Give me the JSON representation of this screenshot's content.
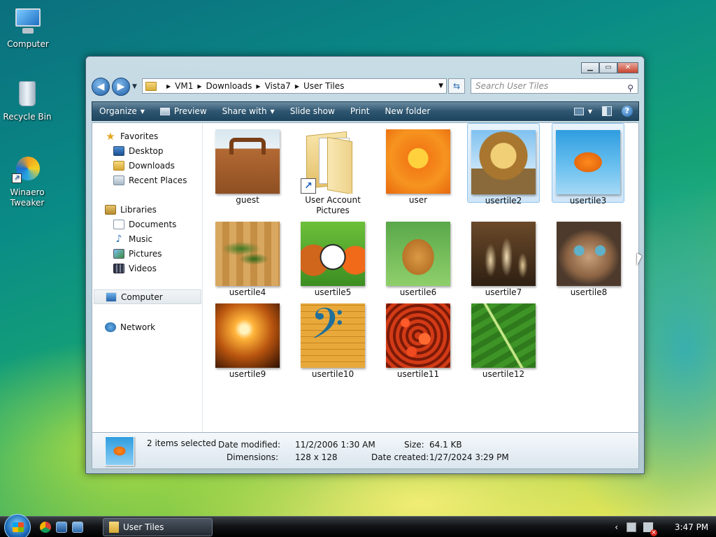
{
  "desktop": {
    "icons": [
      {
        "label": "Computer"
      },
      {
        "label": "Recycle Bin"
      },
      {
        "label": "Winaero Tweaker"
      }
    ]
  },
  "window": {
    "controls": {
      "minimize": "▁",
      "maximize": "▭",
      "close": "✕"
    },
    "nav": {
      "back": "◀",
      "forward": "▶"
    },
    "address": {
      "crumbs": [
        "VM1",
        "Downloads",
        "Vista7",
        "User Tiles"
      ],
      "separator": "▶"
    },
    "search": {
      "placeholder": "Search User Tiles"
    },
    "toolbar": {
      "organize": "Organize",
      "preview": "Preview",
      "share_with": "Share with",
      "slide_show": "Slide show",
      "print": "Print",
      "new_folder": "New folder",
      "help": "?"
    },
    "nav_pane": {
      "favorites": "Favorites",
      "desktop": "Desktop",
      "downloads": "Downloads",
      "recent_places": "Recent Places",
      "libraries": "Libraries",
      "documents": "Documents",
      "music": "Music",
      "pictures": "Pictures",
      "videos": "Videos",
      "computer": "Computer",
      "network": "Network"
    },
    "files": [
      {
        "name": "guest",
        "selected": false
      },
      {
        "name": "User Account Pictures",
        "selected": false
      },
      {
        "name": "user",
        "selected": false
      },
      {
        "name": "usertile2",
        "selected": true
      },
      {
        "name": "usertile3",
        "selected": true
      },
      {
        "name": "usertile4",
        "selected": false
      },
      {
        "name": "usertile5",
        "selected": false
      },
      {
        "name": "usertile6",
        "selected": false
      },
      {
        "name": "usertile7",
        "selected": false
      },
      {
        "name": "usertile8",
        "selected": false
      },
      {
        "name": "usertile9",
        "selected": false
      },
      {
        "name": "usertile10",
        "selected": false
      },
      {
        "name": "usertile11",
        "selected": false
      },
      {
        "name": "usertile12",
        "selected": false
      }
    ],
    "details": {
      "selection": "2 items selected",
      "date_modified_label": "Date modified:",
      "date_modified": "11/2/2006 1:30 AM",
      "dimensions_label": "Dimensions:",
      "dimensions": "128 x 128",
      "size_label": "Size:",
      "size": "64.1 KB",
      "date_created_label": "Date created:",
      "date_created": "1/27/2024 3:29 PM"
    }
  },
  "taskbar": {
    "window_button": "User Tiles",
    "tray_chevron": "‹",
    "clock": "3:47 PM"
  }
}
